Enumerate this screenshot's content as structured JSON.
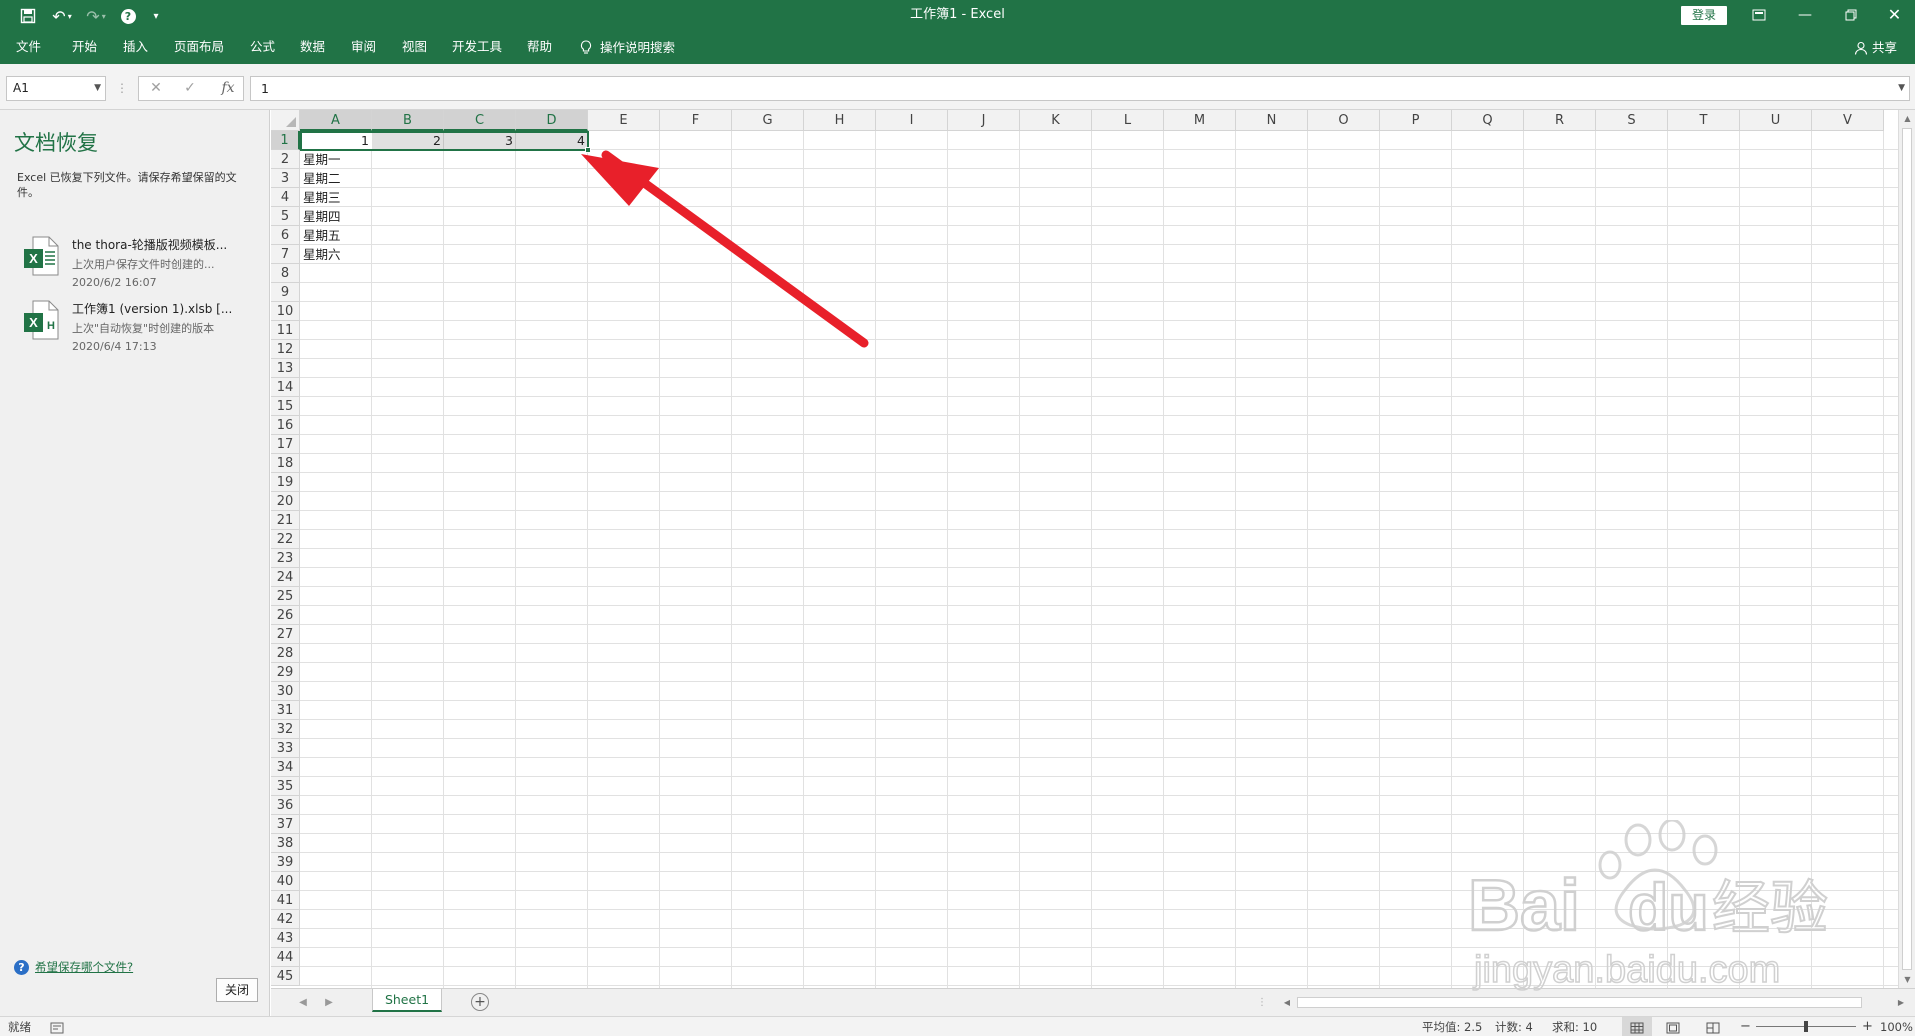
{
  "window": {
    "title": "工作簿1  -  Excel",
    "login_label": "登录",
    "share_label": "共享"
  },
  "ribbon": {
    "tabs": [
      "文件",
      "开始",
      "插入",
      "页面布局",
      "公式",
      "数据",
      "审阅",
      "视图",
      "开发工具",
      "帮助"
    ],
    "tell_me": "操作说明搜索"
  },
  "formula_bar": {
    "name_box": "A1",
    "fx_label": "fx",
    "value": "1"
  },
  "recovery": {
    "title": "文档恢复",
    "description": "Excel 已恢复下列文件。请保存希望保留的文件。",
    "files": [
      {
        "name": "the thora-轮播版视频模板...",
        "subtitle": "上次用户保存文件时创建的...",
        "date": "2020/6/2 16:07"
      },
      {
        "name": "工作簿1 (version 1).xlsb  [...",
        "subtitle": "上次\"自动恢复\"时创建的版本",
        "date": "2020/6/4 17:13"
      }
    ],
    "help_link": "希望保存哪个文件?",
    "close_label": "关闭"
  },
  "grid": {
    "columns": [
      "A",
      "B",
      "C",
      "D",
      "E",
      "F",
      "G",
      "H",
      "I",
      "J",
      "K",
      "L",
      "M",
      "N",
      "O",
      "P",
      "Q",
      "R",
      "S",
      "T",
      "U",
      "V"
    ],
    "row_count": 45,
    "cells": {
      "A1": "1",
      "B1": "2",
      "C1": "3",
      "D1": "4",
      "A2": "星期一",
      "A3": "星期二",
      "A4": "星期三",
      "A5": "星期四",
      "A6": "星期五",
      "A7": "星期六"
    },
    "selection": "A1:D1",
    "annotation_color": "#e8202a"
  },
  "sheets": {
    "tabs": [
      "Sheet1"
    ]
  },
  "status": {
    "ready": "就绪",
    "average": "平均值: 2.5",
    "count": "计数: 4",
    "sum": "求和: 10",
    "zoom": "100%"
  },
  "watermark": {
    "brand": "Bai",
    "brand2": "du",
    "jingyan": "经验",
    "url": "jingyan.baidu.com"
  },
  "colors": {
    "accent": "#217346"
  }
}
